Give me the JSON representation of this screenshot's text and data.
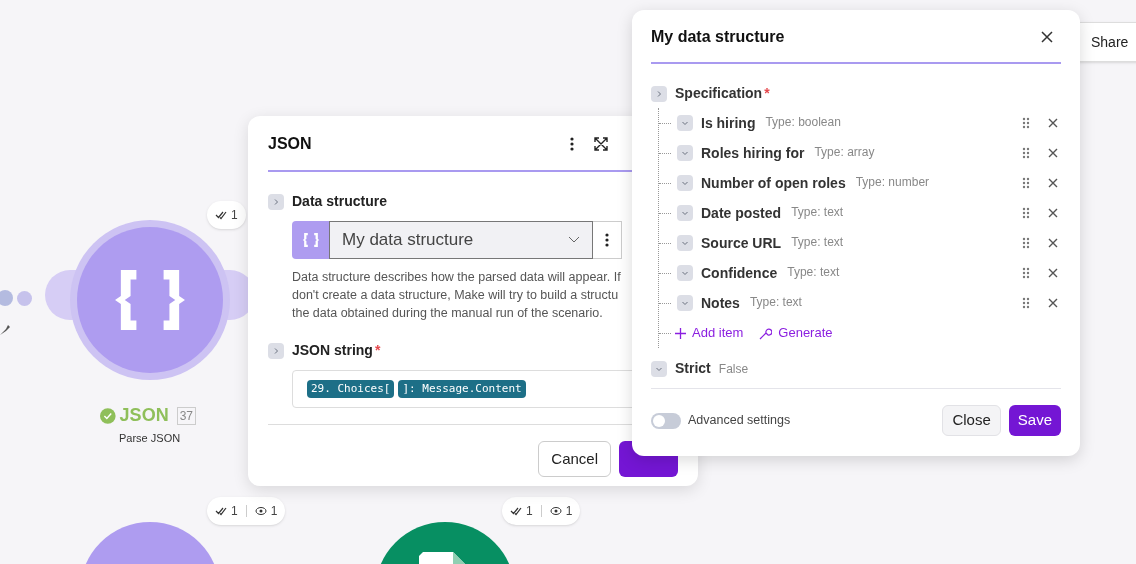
{
  "canvas": {
    "main_node": {
      "title": "JSON",
      "number": "37",
      "subtitle": "Parse JSON",
      "succeeded": true
    },
    "badges": [
      {
        "operations": "1"
      },
      {
        "operations": "1",
        "bundles": "1"
      },
      {
        "operations": "1",
        "bundles": "1"
      }
    ],
    "partial_nodes": [
      {
        "kind": "json"
      },
      {
        "kind": "sheet"
      }
    ]
  },
  "share": {
    "label": "Share"
  },
  "json_dialog": {
    "title": "JSON",
    "data_structure": {
      "label": "Data structure",
      "value": "My data structure",
      "help": [
        "Data structure describes how the parsed data will appear. If",
        "don't create a data structure, Make will try to build a structu",
        "the data obtained during the manual run of the scenario."
      ]
    },
    "json_string": {
      "label": "JSON string",
      "required_mark": "*",
      "tokens": [
        "29. Choices[",
        "]: Message.Content"
      ]
    },
    "buttons": [
      {
        "kind": "secondary",
        "label": "Cancel"
      },
      {
        "kind": "primary"
      }
    ]
  },
  "structure_dialog": {
    "title": "My data structure",
    "specification": {
      "label": "Specification",
      "required_mark": "*"
    },
    "items": [
      {
        "name": "Is hiring",
        "type": "Type: boolean"
      },
      {
        "name": "Roles hiring for",
        "type": "Type: array"
      },
      {
        "name": "Number of open roles",
        "type": "Type: number"
      },
      {
        "name": "Date posted",
        "type": "Type: text"
      },
      {
        "name": "Source URL",
        "type": "Type: text"
      },
      {
        "name": "Confidence",
        "type": "Type: text"
      },
      {
        "name": "Notes",
        "type": "Type: text"
      }
    ],
    "actions": [
      {
        "kind": "add",
        "label": "Add item"
      },
      {
        "kind": "generate",
        "label": "Generate"
      }
    ],
    "strict": {
      "label": "Strict",
      "value": "False"
    },
    "advanced": {
      "label": "Advanced settings",
      "on": false
    },
    "buttons": [
      {
        "kind": "secondary",
        "label": "Close"
      },
      {
        "kind": "primary",
        "label": "Save"
      }
    ]
  }
}
